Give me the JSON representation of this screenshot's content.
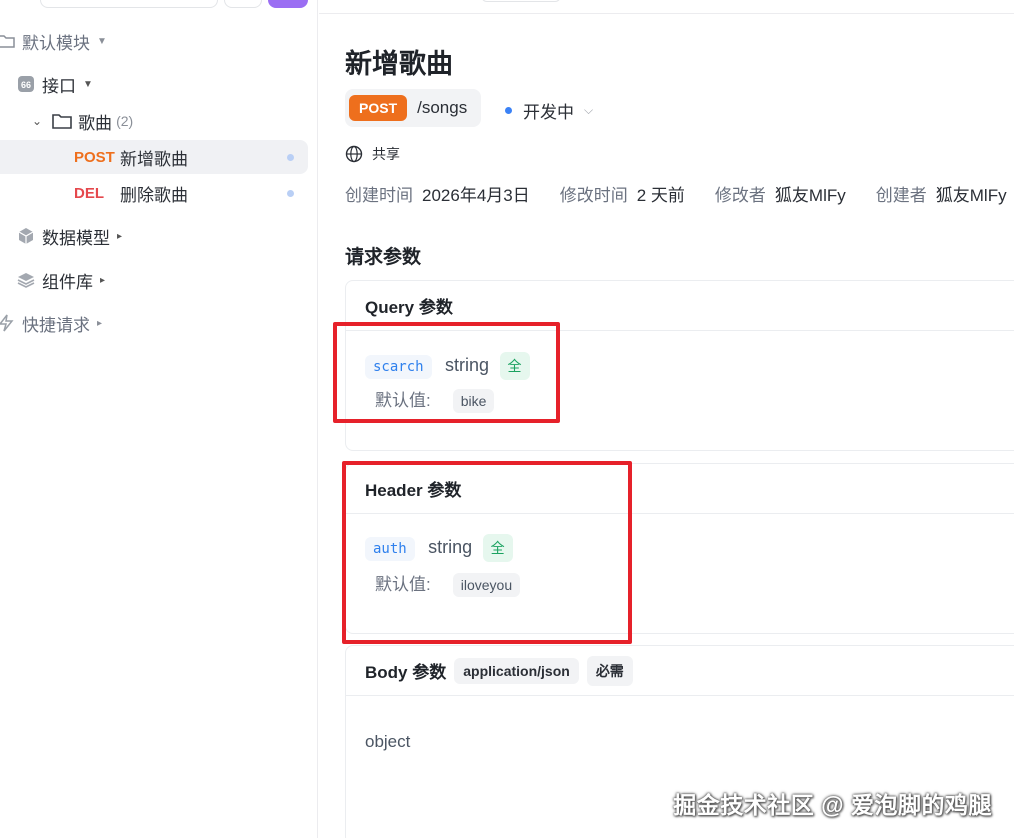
{
  "sidebar": {
    "module_label": "默认模块",
    "interface_label": "接口",
    "folder_label": "歌曲",
    "folder_count": "(2)",
    "items": [
      {
        "method": "POST",
        "label": "新增歌曲",
        "selected": true
      },
      {
        "method": "DEL",
        "label": "删除歌曲",
        "selected": false
      }
    ],
    "data_model_label": "数据模型",
    "components_label": "组件库",
    "quick_request_label": "快捷请求"
  },
  "page": {
    "title": "新增歌曲",
    "method": "POST",
    "path": "/songs",
    "status": "开发中",
    "share_label": "共享",
    "meta": {
      "created_key": "创建时间",
      "created_val": "2026年4月3日",
      "modified_key": "修改时间",
      "modified_val": "2 天前",
      "modifier_key": "修改者",
      "modifier_val": "狐友MlFy",
      "creator_key": "创建者",
      "creator_val": "狐友MlFy"
    },
    "section_title": "请求参数"
  },
  "query": {
    "title": "Query 参数",
    "param_name": "scarch",
    "param_type": "string",
    "required_mark": "全",
    "default_label": "默认值:",
    "default_value": "bike"
  },
  "header": {
    "title": "Header 参数",
    "param_name": "auth",
    "param_type": "string",
    "required_mark": "全",
    "default_label": "默认值:",
    "default_value": "iloveyou"
  },
  "body": {
    "title": "Body 参数",
    "content_type": "application/json",
    "required": "必需",
    "type_text": "object"
  },
  "watermark": "掘金技术社区 @ 爱泡脚的鸡腿",
  "colors": {
    "post": "#ee6f1d",
    "del": "#e5484d",
    "highlight": "#e6212a",
    "status_dot": "#3b82f6"
  }
}
